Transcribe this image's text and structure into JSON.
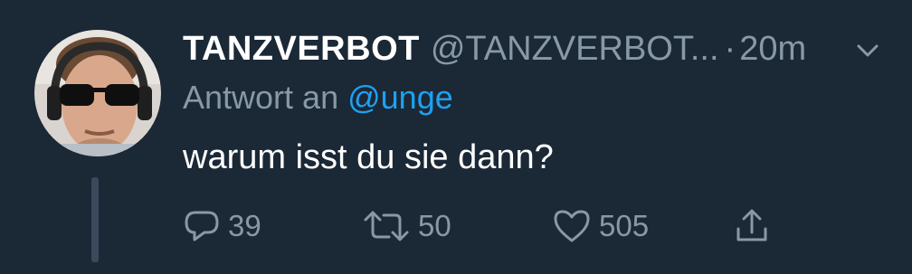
{
  "tweet": {
    "display_name": "TANZVERBOT",
    "handle": "@TANZVERBOT...",
    "separator": "·",
    "time": "20m",
    "reply_prefix": "Antwort an",
    "reply_to": "@unge",
    "text": "warum isst du sie dann?"
  },
  "actions": {
    "reply_count": "39",
    "retweet_count": "50",
    "like_count": "505"
  },
  "icons": {
    "avatar": "user-avatar",
    "chevron": "chevron-down-icon",
    "reply": "reply-icon",
    "retweet": "retweet-icon",
    "like": "heart-icon",
    "share": "share-icon"
  },
  "colors": {
    "background": "#1b2836",
    "text_primary": "#ffffff",
    "text_secondary": "#8899a6",
    "link": "#1da1f2"
  }
}
